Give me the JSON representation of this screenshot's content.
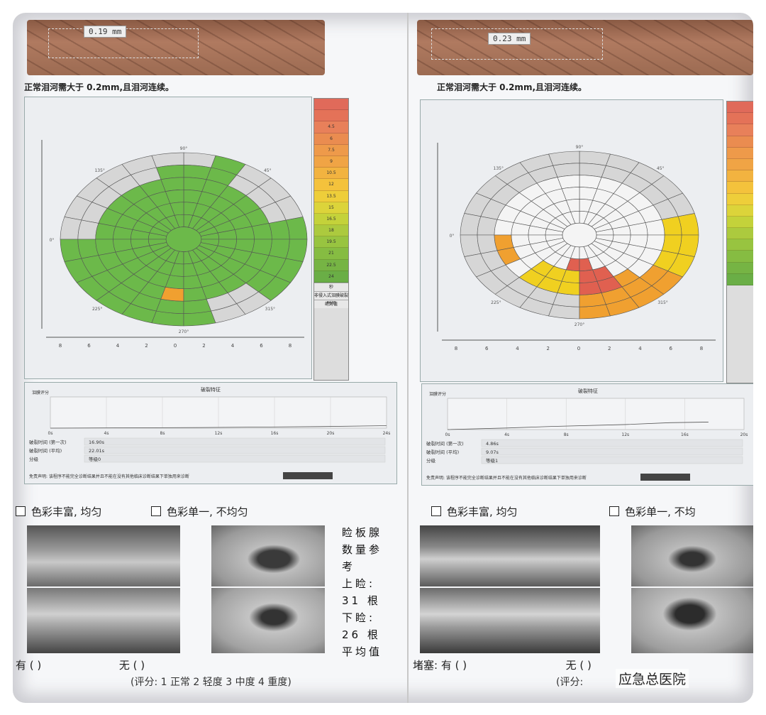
{
  "left": {
    "measure": "0.19 mm",
    "caption": "正常泪河需大于 0.2mm,且泪河连续。",
    "scale": {
      "labels": [
        "",
        "",
        "4.5",
        "6",
        "7.5",
        "9",
        "10.5",
        "12",
        "13.5",
        "15",
        "16.5",
        "18",
        "19.5",
        "21",
        "22.5",
        "24"
      ],
      "colors": [
        "#e06a5a",
        "#e47258",
        "#e8805a",
        "#ea8c50",
        "#ee9a4a",
        "#f0a445",
        "#f2b340",
        "#f4c23c",
        "#eece3a",
        "#dcd43a",
        "#c4d23a",
        "#acca3e",
        "#98c440",
        "#86bc42",
        "#76b444",
        "#6aae46"
      ],
      "buttons": [
        "秒",
        "非侵入式泪膜破裂时间",
        "绝对值"
      ]
    },
    "axis_labels": {
      "top": "90°",
      "left": "0°",
      "bottom": "270°",
      "ul": "135°",
      "ur": "45°",
      "ll": "225°",
      "lr": "315°"
    },
    "ticks": [
      "8",
      "6",
      "4",
      "2",
      "0",
      "2",
      "4",
      "6",
      "8"
    ],
    "yticks": [
      "8",
      "6",
      "4",
      "2",
      "0",
      "2",
      "4",
      "6",
      "8"
    ],
    "graph_title": "破裂特征",
    "graph_ylabel": "泪膜评分",
    "xticks": [
      "0s",
      "4s",
      "8s",
      "12s",
      "16s",
      "20s",
      "24s"
    ],
    "rows": [
      {
        "label": "破裂时间 (第一次)",
        "value": "16.90s"
      },
      {
        "label": "破裂时间 (平均)",
        "value": "22.01s"
      },
      {
        "label": "分级",
        "value": "等级0"
      }
    ],
    "disclaimer": "免责声明: 该程序不能完全诊断结果并且不能在没有其他临床诊断结果下单独用来诊断",
    "check1": "色彩丰富, 均匀",
    "check2": "色彩单一, 不均匀",
    "side_text": [
      "睑板腺",
      "数量参",
      "考",
      "上睑:",
      "31 根",
      "下睑:",
      "26 根",
      "平均值"
    ],
    "block_yes": "有 ( )",
    "block_no": "无 ( )",
    "block_prefix": "堵塞:",
    "score": "(评分: 1 正常 2 轻度 3 中度 4 重度)"
  },
  "right": {
    "measure": "0.23 mm",
    "caption": "正常泪河需大于 0.2mm,且泪河连续。",
    "graph_title": "破裂特征",
    "graph_ylabel": "泪膜评分",
    "xticks": [
      "0s",
      "4s",
      "8s",
      "12s",
      "16s",
      "20s"
    ],
    "rows": [
      {
        "label": "破裂时间 (第一次)",
        "value": "4.86s"
      },
      {
        "label": "破裂时间 (平均)",
        "value": "9.07s"
      },
      {
        "label": "分级",
        "value": "等级1"
      }
    ],
    "disclaimer": "免责声明: 该程序不能完全诊断结果并且不能在没有其他临床诊断结果下单独用来诊断",
    "check1": "色彩丰富, 均匀",
    "check2": "色彩单一, 不均",
    "block_prefix": "堵塞:",
    "block_yes": "有 ( )",
    "block_no": "无 ( )",
    "score": "(评分:"
  },
  "watermark": "应急总医院",
  "colors": {
    "green": "#6cb94a",
    "gray": "#d6d6d6",
    "orange": "#f0a030",
    "red": "#e06050",
    "yellow": "#f0d020",
    "white": "#f4f4f4"
  }
}
